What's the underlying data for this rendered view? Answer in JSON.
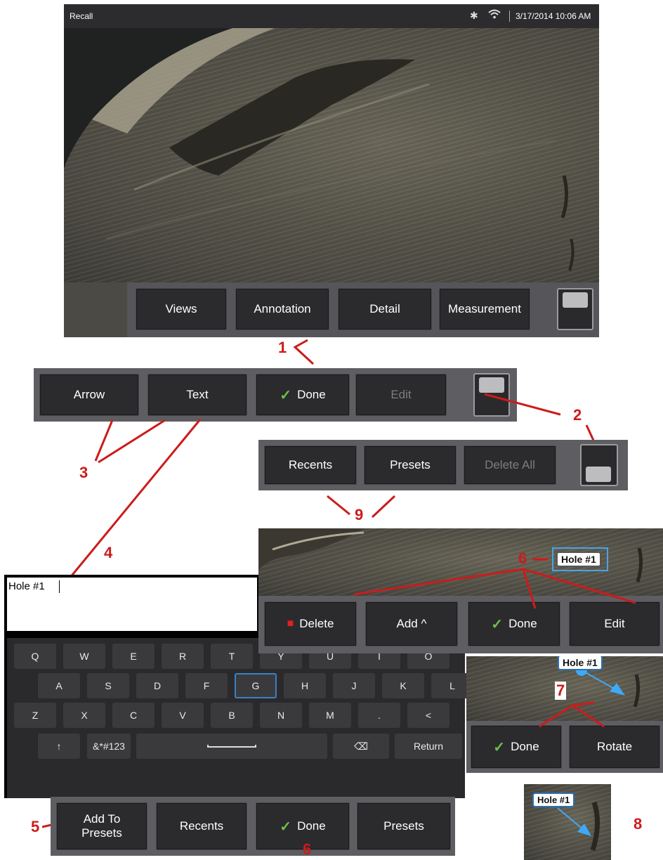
{
  "status_bar": {
    "title": "Recall",
    "datetime": "3/17/2014 10:06 AM"
  },
  "main_menu": {
    "views": "Views",
    "annotation": "Annotation",
    "detail": "Detail",
    "measurement": "Measurement"
  },
  "annotation_menu": {
    "arrow": "Arrow",
    "text": "Text",
    "done": "Done",
    "edit": "Edit"
  },
  "second_menu": {
    "recents": "Recents",
    "presets": "Presets",
    "delete_all": "Delete All"
  },
  "callouts": {
    "c1": "1",
    "c2": "2",
    "c3": "3",
    "c4": "4",
    "c5": "5",
    "c6a": "6",
    "c6b": "6",
    "c7": "7",
    "c8": "8",
    "c9": "9"
  },
  "text_entry": {
    "value": "Hole #1"
  },
  "keyboard": {
    "row1": [
      "Q",
      "W",
      "E",
      "R",
      "T",
      "Y",
      "U",
      "I",
      "O"
    ],
    "row2": [
      "A",
      "S",
      "D",
      "F",
      "G",
      "H",
      "J",
      "K",
      "L"
    ],
    "row3": [
      "Z",
      "X",
      "C",
      "V",
      "B",
      "N",
      "M",
      ".",
      "<"
    ],
    "shift": "↑",
    "symbols": "&*#123",
    "backspace": "⌫",
    "return": "Return"
  },
  "keyboard_menu": {
    "add_to_presets_line1": "Add To",
    "add_to_presets_line2": "Presets",
    "recents": "Recents",
    "done": "Done",
    "presets": "Presets"
  },
  "label_menu": {
    "delete": "Delete",
    "add": "Add ^",
    "done": "Done",
    "edit": "Edit",
    "label": "Hole #1"
  },
  "arrow_menu": {
    "label": "Hole #1",
    "done": "Done",
    "rotate": "Rotate"
  },
  "final_view": {
    "label": "Hole #1"
  },
  "colors": {
    "accent_blue": "#2e6fb5",
    "callout_red": "#cc1b1b",
    "check_green": "#6cc04a",
    "button_bg": "#2b2b2e"
  }
}
